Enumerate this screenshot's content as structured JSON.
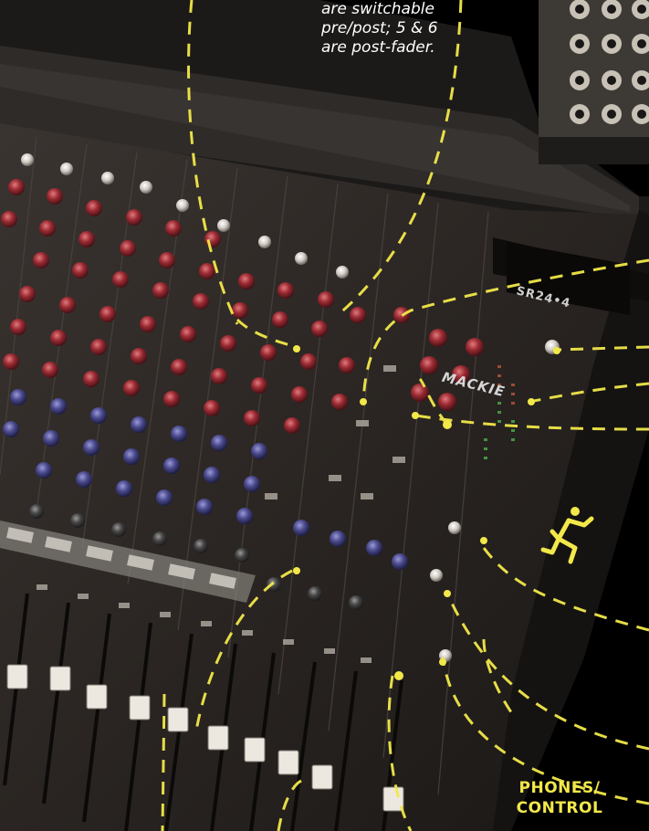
{
  "caption": {
    "lines": [
      "are switchable",
      "pre/post; 5 & 6",
      "are post-fader."
    ]
  },
  "corner_label": {
    "lines": [
      "PHONES/",
      "CONTROL"
    ]
  },
  "console": {
    "brand": "MACKIE",
    "model": "SR24•4"
  },
  "colors": {
    "callout_line": "#f2e84a",
    "knob_red": "#a0323a",
    "knob_blue": "#4a4a8c",
    "panel": "#2a2624",
    "background": "#000000"
  },
  "icons": [
    "running-man-logo"
  ]
}
